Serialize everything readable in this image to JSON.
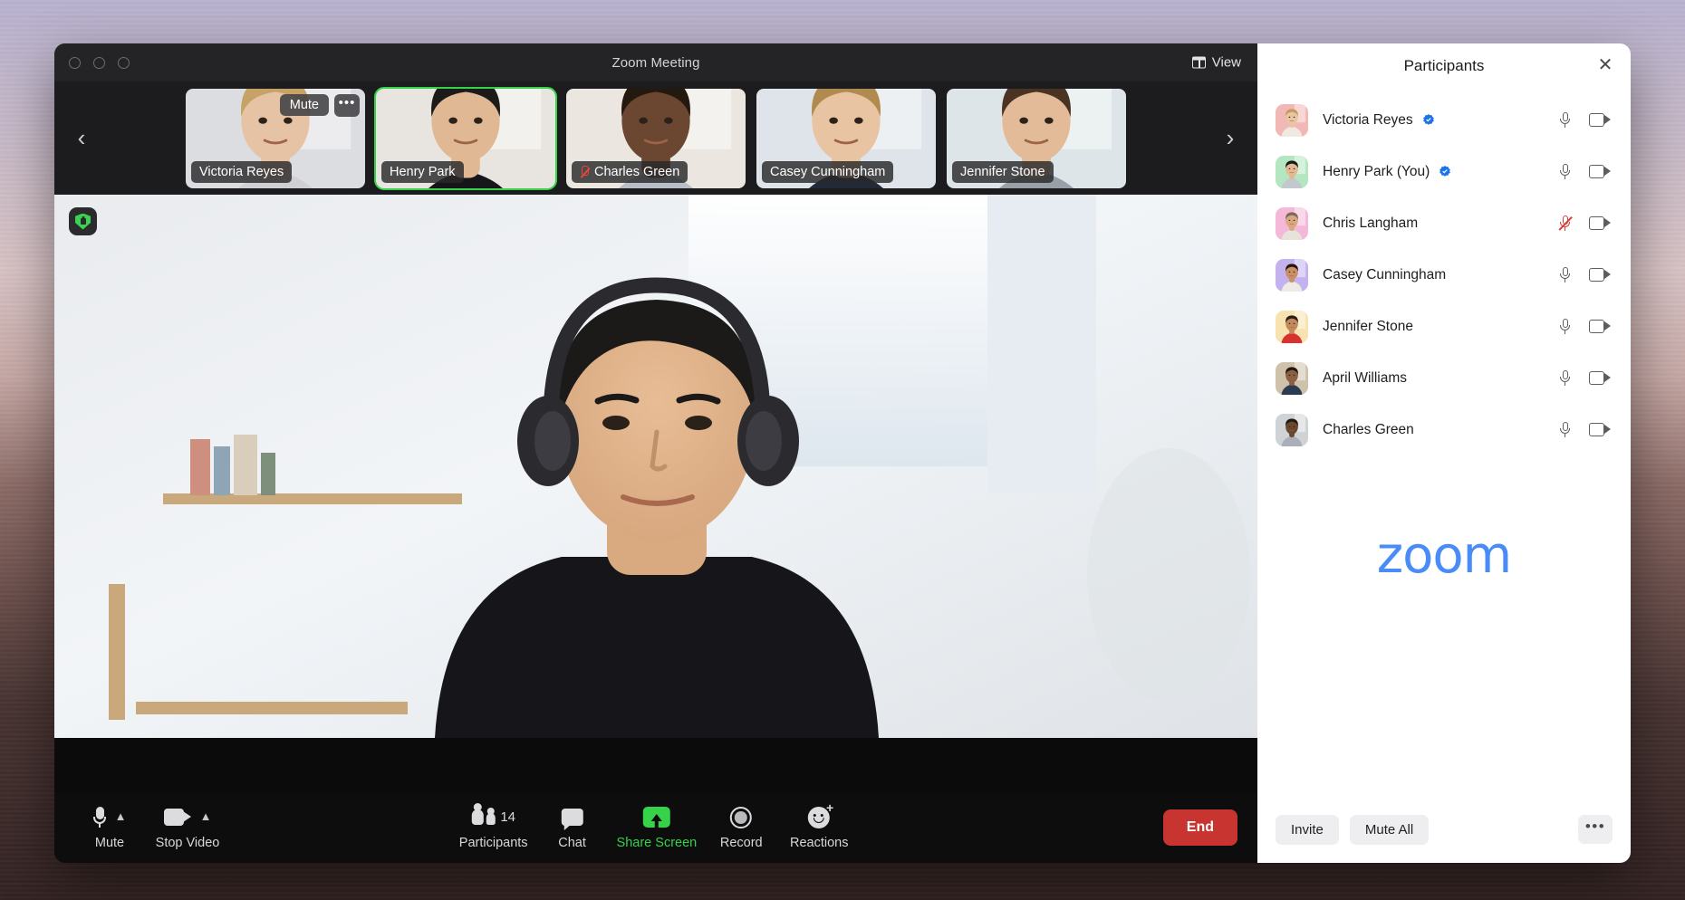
{
  "window": {
    "title": "Zoom Meeting",
    "view_label": "View",
    "view_icon": "grid-view-icon",
    "traffic_lights": [
      "close",
      "minimize",
      "maximize"
    ]
  },
  "filmstrip": {
    "prev_arrow": "‹",
    "next_arrow": "›",
    "hover_mute_label": "Mute",
    "hover_more_label": "•••",
    "thumbnails": [
      {
        "name": "Victoria Reyes",
        "active": false,
        "muted": false,
        "hover": true,
        "bg": "#dcdde1",
        "skin": "#e6c3a5",
        "hair": "#c7a267",
        "shirt": "#cfcfd4"
      },
      {
        "name": "Henry Park",
        "active": true,
        "muted": false,
        "hover": false,
        "bg": "#e8e5e0",
        "skin": "#e0b894",
        "hair": "#1c1b1a",
        "shirt": "#16161a"
      },
      {
        "name": "Charles Green",
        "active": false,
        "muted": true,
        "hover": false,
        "bg": "#ebe7e0",
        "skin": "#6b4630",
        "hair": "#24190f",
        "shirt": "#b9bec6"
      },
      {
        "name": "Casey Cunningham",
        "active": false,
        "muted": false,
        "hover": false,
        "bg": "#dfe4ea",
        "skin": "#e8c4a2",
        "hair": "#b08a4e",
        "shirt": "#222a38"
      },
      {
        "name": "Jennifer Stone",
        "active": false,
        "muted": false,
        "hover": false,
        "bg": "#dde5e8",
        "skin": "#e3bb98",
        "hair": "#4b3324",
        "shirt": "#9aa0a8"
      }
    ]
  },
  "stage": {
    "security_badge": "security-shield-icon",
    "speaker": "Henry Park"
  },
  "toolbar": {
    "mute_label": "Mute",
    "stop_video_label": "Stop Video",
    "participants_label": "Participants",
    "participants_count": "14",
    "chat_label": "Chat",
    "share_screen_label": "Share Screen",
    "record_label": "Record",
    "reactions_label": "Reactions",
    "end_label": "End",
    "share_accent": "#35d24a",
    "end_color": "#c8342f"
  },
  "panel": {
    "title": "Participants",
    "close_icon": "close-icon",
    "logo_text": "zoom",
    "logo_color": "#4a8cf7",
    "invite_label": "Invite",
    "mute_all_label": "Mute All",
    "more_label": "•••",
    "participants": [
      {
        "name": "Victoria Reyes",
        "verified": true,
        "mic_muted": false,
        "video_on": true,
        "avatar_bg": "#f2b8b6",
        "skin": "#e9c5a4",
        "hair": "#c89a63",
        "shirt": "#f0e9e2"
      },
      {
        "name": "Henry Park (You)",
        "verified": true,
        "mic_muted": false,
        "video_on": true,
        "avatar_bg": "#b4e7c0",
        "skin": "#e2b895",
        "hair": "#1a1918",
        "shirt": "#c3c8cf"
      },
      {
        "name": "Chris Langham",
        "verified": false,
        "mic_muted": true,
        "video_on": true,
        "avatar_bg": "#f4b9d8",
        "skin": "#d9a87e",
        "hair": "#7b6a5c",
        "shirt": "#e7e2da"
      },
      {
        "name": "Casey Cunningham",
        "verified": false,
        "mic_muted": false,
        "video_on": true,
        "avatar_bg": "#c4b2ee",
        "skin": "#c99068",
        "hair": "#231710",
        "shirt": "#efeae4"
      },
      {
        "name": "Jennifer Stone",
        "verified": false,
        "mic_muted": false,
        "video_on": true,
        "avatar_bg": "#f8e2b0",
        "skin": "#c28a5c",
        "hair": "#2b1d13",
        "shirt": "#d8322e"
      },
      {
        "name": "April Williams",
        "verified": false,
        "mic_muted": false,
        "video_on": true,
        "avatar_bg": "#cfc2ab",
        "skin": "#8a5f42",
        "hair": "#20160f",
        "shirt": "#2c3a52"
      },
      {
        "name": "Charles Green",
        "verified": false,
        "mic_muted": false,
        "video_on": true,
        "avatar_bg": "#cfd3d6",
        "skin": "#6c4730",
        "hair": "#241a10",
        "shirt": "#a9b0ba"
      }
    ]
  }
}
